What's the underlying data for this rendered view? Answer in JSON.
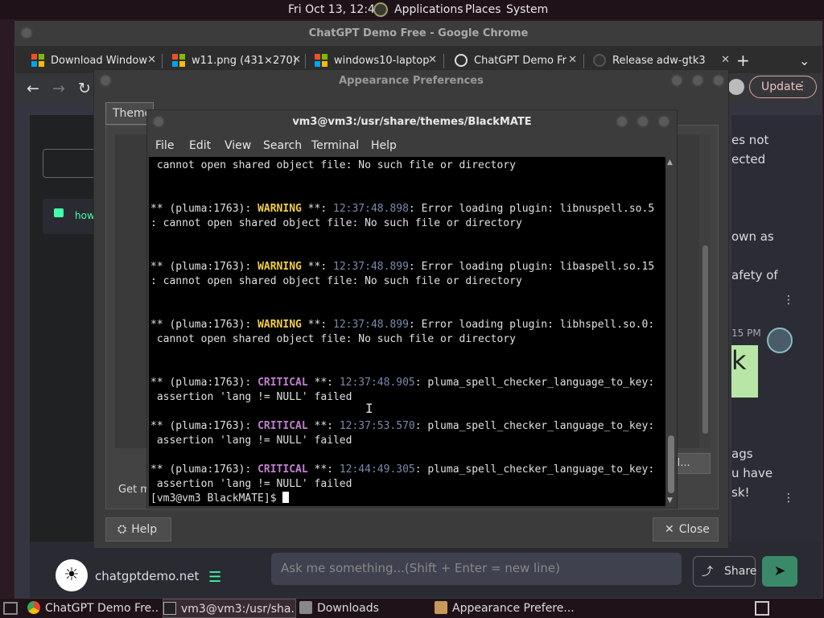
{
  "top_panel": {
    "clock": "Fri Oct 13, 12:45",
    "menus": [
      "Applications",
      "Places",
      "System"
    ]
  },
  "chrome": {
    "window_title": "ChatGPT Demo Free - Google Chrome",
    "tabs": [
      {
        "label": "Download Window",
        "icon": "windows-logo-icon"
      },
      {
        "label": "w11.png (431×270)",
        "icon": "windows-logo-icon"
      },
      {
        "label": "windows10-laptop",
        "icon": "windows-logo-icon"
      },
      {
        "label": "ChatGPT Demo Fr",
        "icon": "globe-icon"
      },
      {
        "label": "Release adw-gtk3",
        "icon": "github-icon"
      }
    ],
    "new_tab": "+",
    "tab_menu": "⌄",
    "update_label": "Update",
    "page": {
      "right_texts": [
        "es not",
        "ected",
        "own as",
        "afety of",
        "15 PM",
        "k",
        "ags",
        "u have",
        "sk!"
      ],
      "sidebar_item": "how",
      "input_placeholder": "Ask me something...(Shift + Enter = new line)",
      "share_label": "Share",
      "site_name": "chatgptdemo.net"
    }
  },
  "appearance": {
    "title": "Appearance Preferences",
    "tab_theme": "Theme",
    "get_more": "Get m",
    "install_label": "all...",
    "help_label": "Help",
    "close_label": "Close"
  },
  "terminal": {
    "title": "vm3@vm3:/usr/share/themes/BlackMATE",
    "menus": [
      "File",
      "Edit",
      "View",
      "Search",
      "Terminal",
      "Help"
    ],
    "lines": [
      {
        "segments": [
          {
            "text": " cannot open shared object file: No such file or directory",
            "style": "plain"
          }
        ]
      },
      {
        "segments": [
          {
            "text": "",
            "style": "plain"
          }
        ]
      },
      {
        "segments": [
          {
            "text": "",
            "style": "plain"
          }
        ]
      },
      {
        "segments": [
          {
            "text": "** (pluma:1763): ",
            "style": "plain"
          },
          {
            "text": "WARNING",
            "style": "warn"
          },
          {
            "text": " **: ",
            "style": "plain"
          },
          {
            "text": "12:37:48.898",
            "style": "time"
          },
          {
            "text": ": Error loading plugin: libnuspell.so.5",
            "style": "plain"
          }
        ]
      },
      {
        "segments": [
          {
            "text": ": cannot open shared object file: No such file or directory",
            "style": "plain"
          }
        ]
      },
      {
        "segments": [
          {
            "text": "",
            "style": "plain"
          }
        ]
      },
      {
        "segments": [
          {
            "text": "",
            "style": "plain"
          }
        ]
      },
      {
        "segments": [
          {
            "text": "** (pluma:1763): ",
            "style": "plain"
          },
          {
            "text": "WARNING",
            "style": "warn"
          },
          {
            "text": " **: ",
            "style": "plain"
          },
          {
            "text": "12:37:48.899",
            "style": "time"
          },
          {
            "text": ": Error loading plugin: libaspell.so.15",
            "style": "plain"
          }
        ]
      },
      {
        "segments": [
          {
            "text": ": cannot open shared object file: No such file or directory",
            "style": "plain"
          }
        ]
      },
      {
        "segments": [
          {
            "text": "",
            "style": "plain"
          }
        ]
      },
      {
        "segments": [
          {
            "text": "",
            "style": "plain"
          }
        ]
      },
      {
        "segments": [
          {
            "text": "** (pluma:1763): ",
            "style": "plain"
          },
          {
            "text": "WARNING",
            "style": "warn"
          },
          {
            "text": " **: ",
            "style": "plain"
          },
          {
            "text": "12:37:48.899",
            "style": "time"
          },
          {
            "text": ": Error loading plugin: libhspell.so.0:",
            "style": "plain"
          }
        ]
      },
      {
        "segments": [
          {
            "text": " cannot open shared object file: No such file or directory",
            "style": "plain"
          }
        ]
      },
      {
        "segments": [
          {
            "text": "",
            "style": "plain"
          }
        ]
      },
      {
        "segments": [
          {
            "text": "",
            "style": "plain"
          }
        ]
      },
      {
        "segments": [
          {
            "text": "** (pluma:1763): ",
            "style": "plain"
          },
          {
            "text": "CRITICAL",
            "style": "crit"
          },
          {
            "text": " **: ",
            "style": "plain"
          },
          {
            "text": "12:37:48.905",
            "style": "time"
          },
          {
            "text": ": pluma_spell_checker_language_to_key:",
            "style": "plain"
          }
        ]
      },
      {
        "segments": [
          {
            "text": " assertion 'lang != NULL' failed",
            "style": "plain"
          }
        ]
      },
      {
        "segments": [
          {
            "text": "",
            "style": "plain"
          }
        ]
      },
      {
        "segments": [
          {
            "text": "** (pluma:1763): ",
            "style": "plain"
          },
          {
            "text": "CRITICAL",
            "style": "crit"
          },
          {
            "text": " **: ",
            "style": "plain"
          },
          {
            "text": "12:37:53.570",
            "style": "time"
          },
          {
            "text": ": pluma_spell_checker_language_to_key:",
            "style": "plain"
          }
        ]
      },
      {
        "segments": [
          {
            "text": " assertion 'lang != NULL' failed",
            "style": "plain"
          }
        ]
      },
      {
        "segments": [
          {
            "text": "",
            "style": "plain"
          }
        ]
      },
      {
        "segments": [
          {
            "text": "** (pluma:1763): ",
            "style": "plain"
          },
          {
            "text": "CRITICAL",
            "style": "crit"
          },
          {
            "text": " **: ",
            "style": "plain"
          },
          {
            "text": "12:44:49.305",
            "style": "time"
          },
          {
            "text": ": pluma_spell_checker_language_to_key:",
            "style": "plain"
          }
        ]
      },
      {
        "segments": [
          {
            "text": " assertion 'lang != NULL' failed",
            "style": "plain"
          }
        ]
      }
    ],
    "prompt": "[vm3@vm3 BlackMATE]$ "
  },
  "taskbar": {
    "items": [
      {
        "label": "ChatGPT Demo Fre...",
        "icon": "chrome-icon"
      },
      {
        "label": "vm3@vm3:/usr/sha...",
        "icon": "terminal-icon"
      },
      {
        "label": "Downloads",
        "icon": "folder-icon"
      },
      {
        "label": "Appearance Prefere...",
        "icon": "appearance-icon"
      }
    ]
  },
  "colors": {
    "warning": "#f4d03f",
    "critical": "#c080d0",
    "timestamp": "#7a8aaa",
    "accent_green": "#3a8a6a"
  }
}
